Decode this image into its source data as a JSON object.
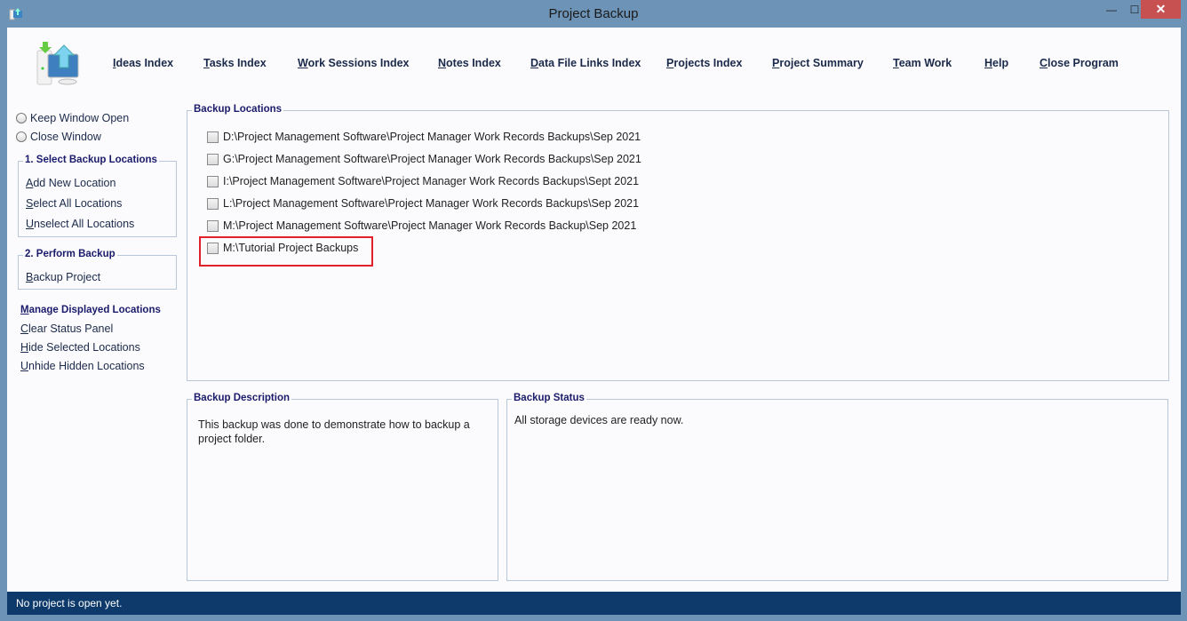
{
  "window": {
    "title": "Project Backup",
    "minimize": "—",
    "maximize": "☐",
    "close": "✕"
  },
  "nav": [
    "Ideas Index",
    "Tasks Index",
    "Work Sessions Index",
    "Notes Index",
    "Data File Links Index",
    "Projects Index",
    "Project Summary",
    "Team Work",
    "Help",
    "Close Program"
  ],
  "options": {
    "keep_open": "Keep Window Open",
    "close_window": "Close Window"
  },
  "select_group": {
    "title": "1. Select Backup Locations",
    "items": [
      "Add New Location",
      "Select All Locations",
      "Unselect All Locations"
    ]
  },
  "perform_group": {
    "title": "2. Perform Backup",
    "items": [
      "Backup Project"
    ]
  },
  "manage": {
    "title": "Manage Displayed Locations",
    "items": [
      "Clear Status Panel",
      "Hide Selected Locations",
      "Unhide Hidden Locations"
    ]
  },
  "backup_locations": {
    "title": "Backup Locations",
    "items": [
      "D:\\Project Management Software\\Project Manager Work Records Backups\\Sep 2021",
      "G:\\Project Management Software\\Project Manager Work Records Backups\\Sep 2021",
      "I:\\Project Management Software\\Project Manager Work Records Backups\\Sept 2021",
      "L:\\Project Management Software\\Project Manager Work Records Backups\\Sep 2021",
      "M:\\Project Management Software\\Project Manager Work Records Backup\\Sep 2021",
      "M:\\Tutorial Project Backups"
    ],
    "highlighted_index": 5,
    "highlight_color": "#e0202a"
  },
  "description": {
    "title": "Backup Description",
    "text": "This backup was done to demonstrate how to backup a project folder."
  },
  "status_panel": {
    "title": "Backup Status",
    "text": "All storage devices are ready now."
  },
  "statusbar": {
    "text": "No project is open yet."
  }
}
